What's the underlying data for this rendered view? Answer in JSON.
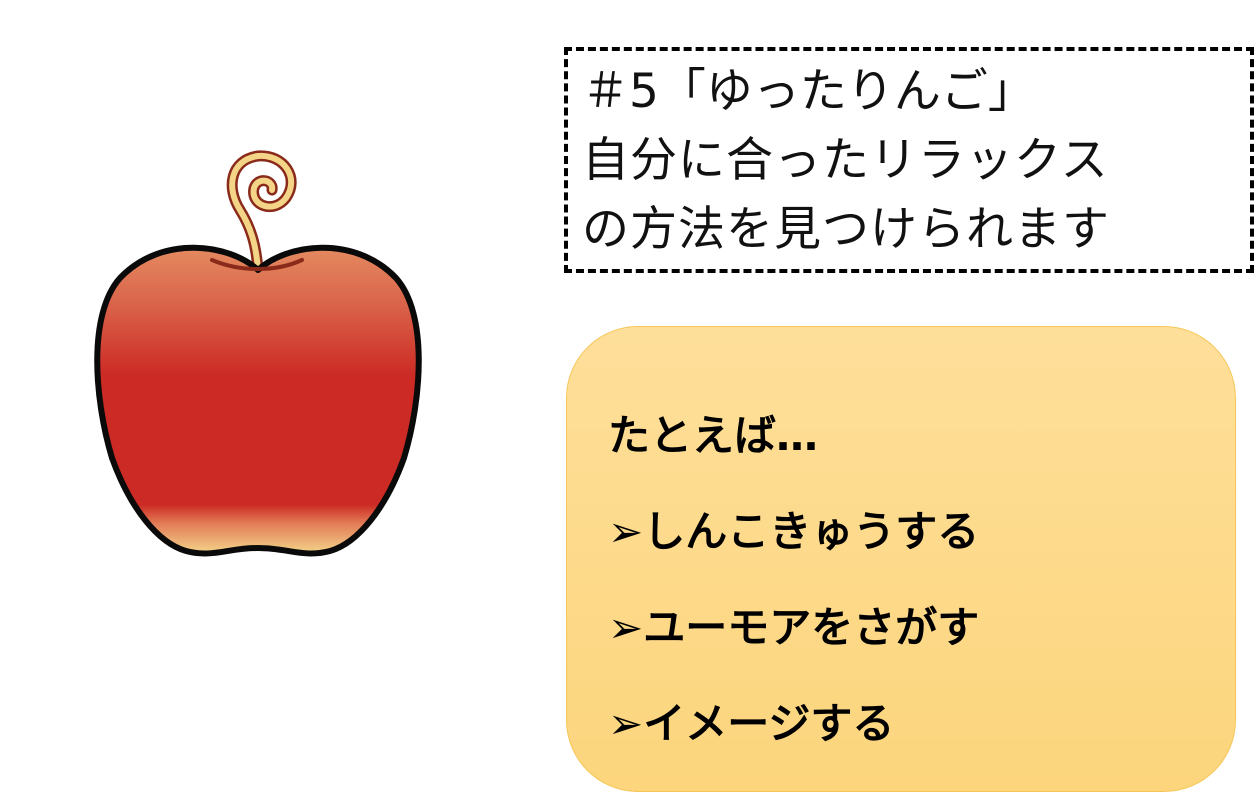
{
  "apple": {
    "icon": "apple-icon",
    "colors": {
      "body": "#cc2a24",
      "highlight": "#e48a60",
      "bottom": "#f3d58a",
      "outline": "#0a0a0a",
      "stem": "#f4d486",
      "stem_outline": "#8a2a1a"
    }
  },
  "title": {
    "line1": "＃5「ゆったりんご」",
    "line2": "自分に合ったリラックス",
    "line3": "の方法を見つけられます"
  },
  "examples": {
    "heading": "たとえば…",
    "items": [
      "➢しんこきゅうする",
      "➢ユーモアをさがす",
      "➢イメージする"
    ],
    "background": "#fdd98a"
  }
}
